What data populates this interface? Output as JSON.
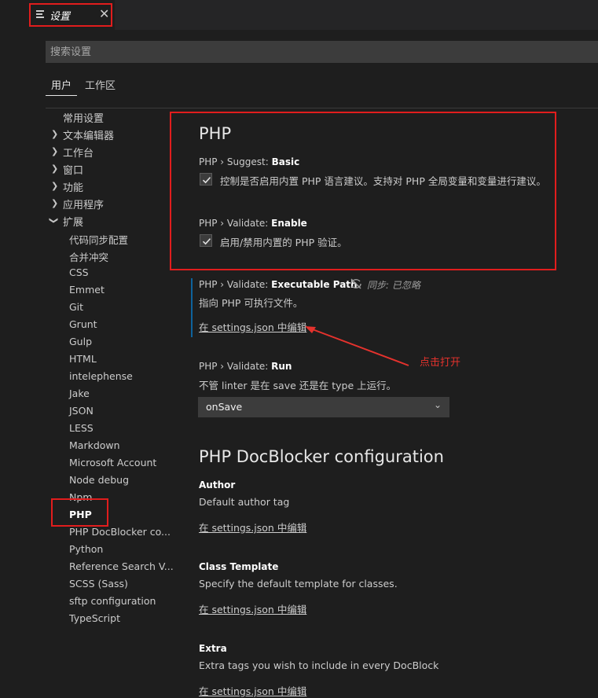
{
  "tab": {
    "title": "设置",
    "close": "✕"
  },
  "search": {
    "placeholder": "搜索设置"
  },
  "scope_tabs": [
    "用户",
    "工作区"
  ],
  "toc": {
    "common": "常用设置",
    "sections": [
      "文本编辑器",
      "工作台",
      "窗口",
      "功能",
      "应用程序"
    ],
    "extensions": "扩展",
    "children": [
      "代码同步配置",
      "合并冲突",
      "CSS",
      "Emmet",
      "Git",
      "Grunt",
      "Gulp",
      "HTML",
      "intelephense",
      "Jake",
      "JSON",
      "LESS",
      "Markdown",
      "Microsoft Account",
      "Node debug",
      "Npm",
      "PHP",
      "PHP DocBlocker co...",
      "Python",
      "Reference Search V...",
      "SCSS (Sass)",
      "sftp configuration",
      "TypeScript"
    ],
    "active": "PHP"
  },
  "php": {
    "heading": "PHP",
    "suggest": {
      "prefix": "PHP › Suggest: ",
      "name": "Basic",
      "desc": "控制是否启用内置 PHP 语言建议。支持对 PHP 全局变量和变量进行建议。",
      "checked": true
    },
    "validate_enable": {
      "prefix": "PHP › Validate: ",
      "name": "Enable",
      "desc": "启用/禁用内置的 PHP 验证。",
      "checked": true
    },
    "exec_path": {
      "prefix": "PHP › Validate: ",
      "name": "Executable Path",
      "sync_note": "同步: 已忽略",
      "desc": "指向 PHP 可执行文件。",
      "link": "在 settings.json 中编辑"
    },
    "run": {
      "prefix": "PHP › Validate: ",
      "name": "Run",
      "desc": "不管 linter 是在 save 还是在 type 上运行。",
      "value": "onSave"
    }
  },
  "docblocker": {
    "heading": "PHP DocBlocker configuration",
    "author": {
      "name": "Author",
      "desc": "Default author tag",
      "link": "在 settings.json 中编辑"
    },
    "class_template": {
      "name": "Class Template",
      "desc": "Specify the default template for classes.",
      "link": "在 settings.json 中编辑"
    },
    "extra": {
      "name": "Extra",
      "desc": "Extra tags you wish to include in every DocBlock",
      "link": "在 settings.json 中编辑"
    }
  },
  "annotation": {
    "text": "点击打开"
  },
  "colors": {
    "highlight": "#e11d1d",
    "annotation": "#e5322d",
    "modified_bar": "#0e639c"
  }
}
